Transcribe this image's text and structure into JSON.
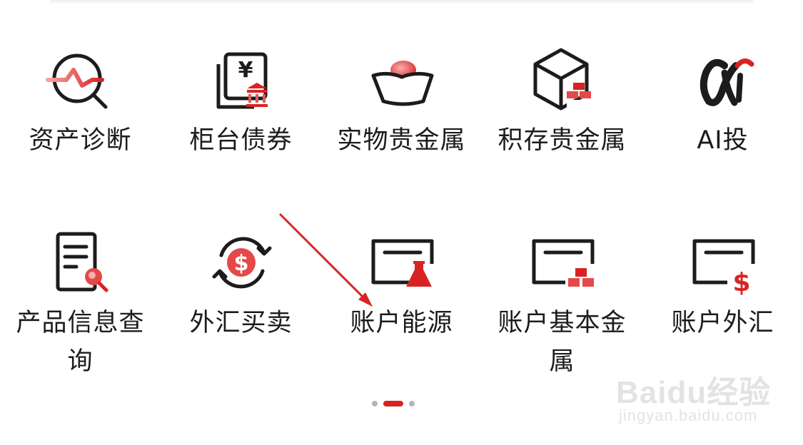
{
  "menu": {
    "items": [
      {
        "label": "资产诊断",
        "icon": "asset-diagnosis-icon"
      },
      {
        "label": "柜台债券",
        "icon": "counter-bond-icon"
      },
      {
        "label": "实物贵金属",
        "icon": "physical-gold-icon"
      },
      {
        "label": "积存贵金属",
        "icon": "gold-accumulation-icon"
      },
      {
        "label": "AI投",
        "icon": "ai-invest-icon"
      },
      {
        "label": "产品信息查询",
        "icon": "product-info-search-icon"
      },
      {
        "label": "外汇买卖",
        "icon": "forex-exchange-icon"
      },
      {
        "label": "账户能源",
        "icon": "account-energy-icon"
      },
      {
        "label": "账户基本金属",
        "icon": "account-base-metal-icon"
      },
      {
        "label": "账户外汇",
        "icon": "account-forex-icon"
      }
    ]
  },
  "pager": {
    "count": 3,
    "active": 2
  },
  "watermark": {
    "main": "Baidu经验",
    "sub": "jingyan.baidu.com"
  },
  "colors": {
    "accent": "#d92323",
    "stroke": "#1c1c1c",
    "text": "#1c1c1c"
  }
}
